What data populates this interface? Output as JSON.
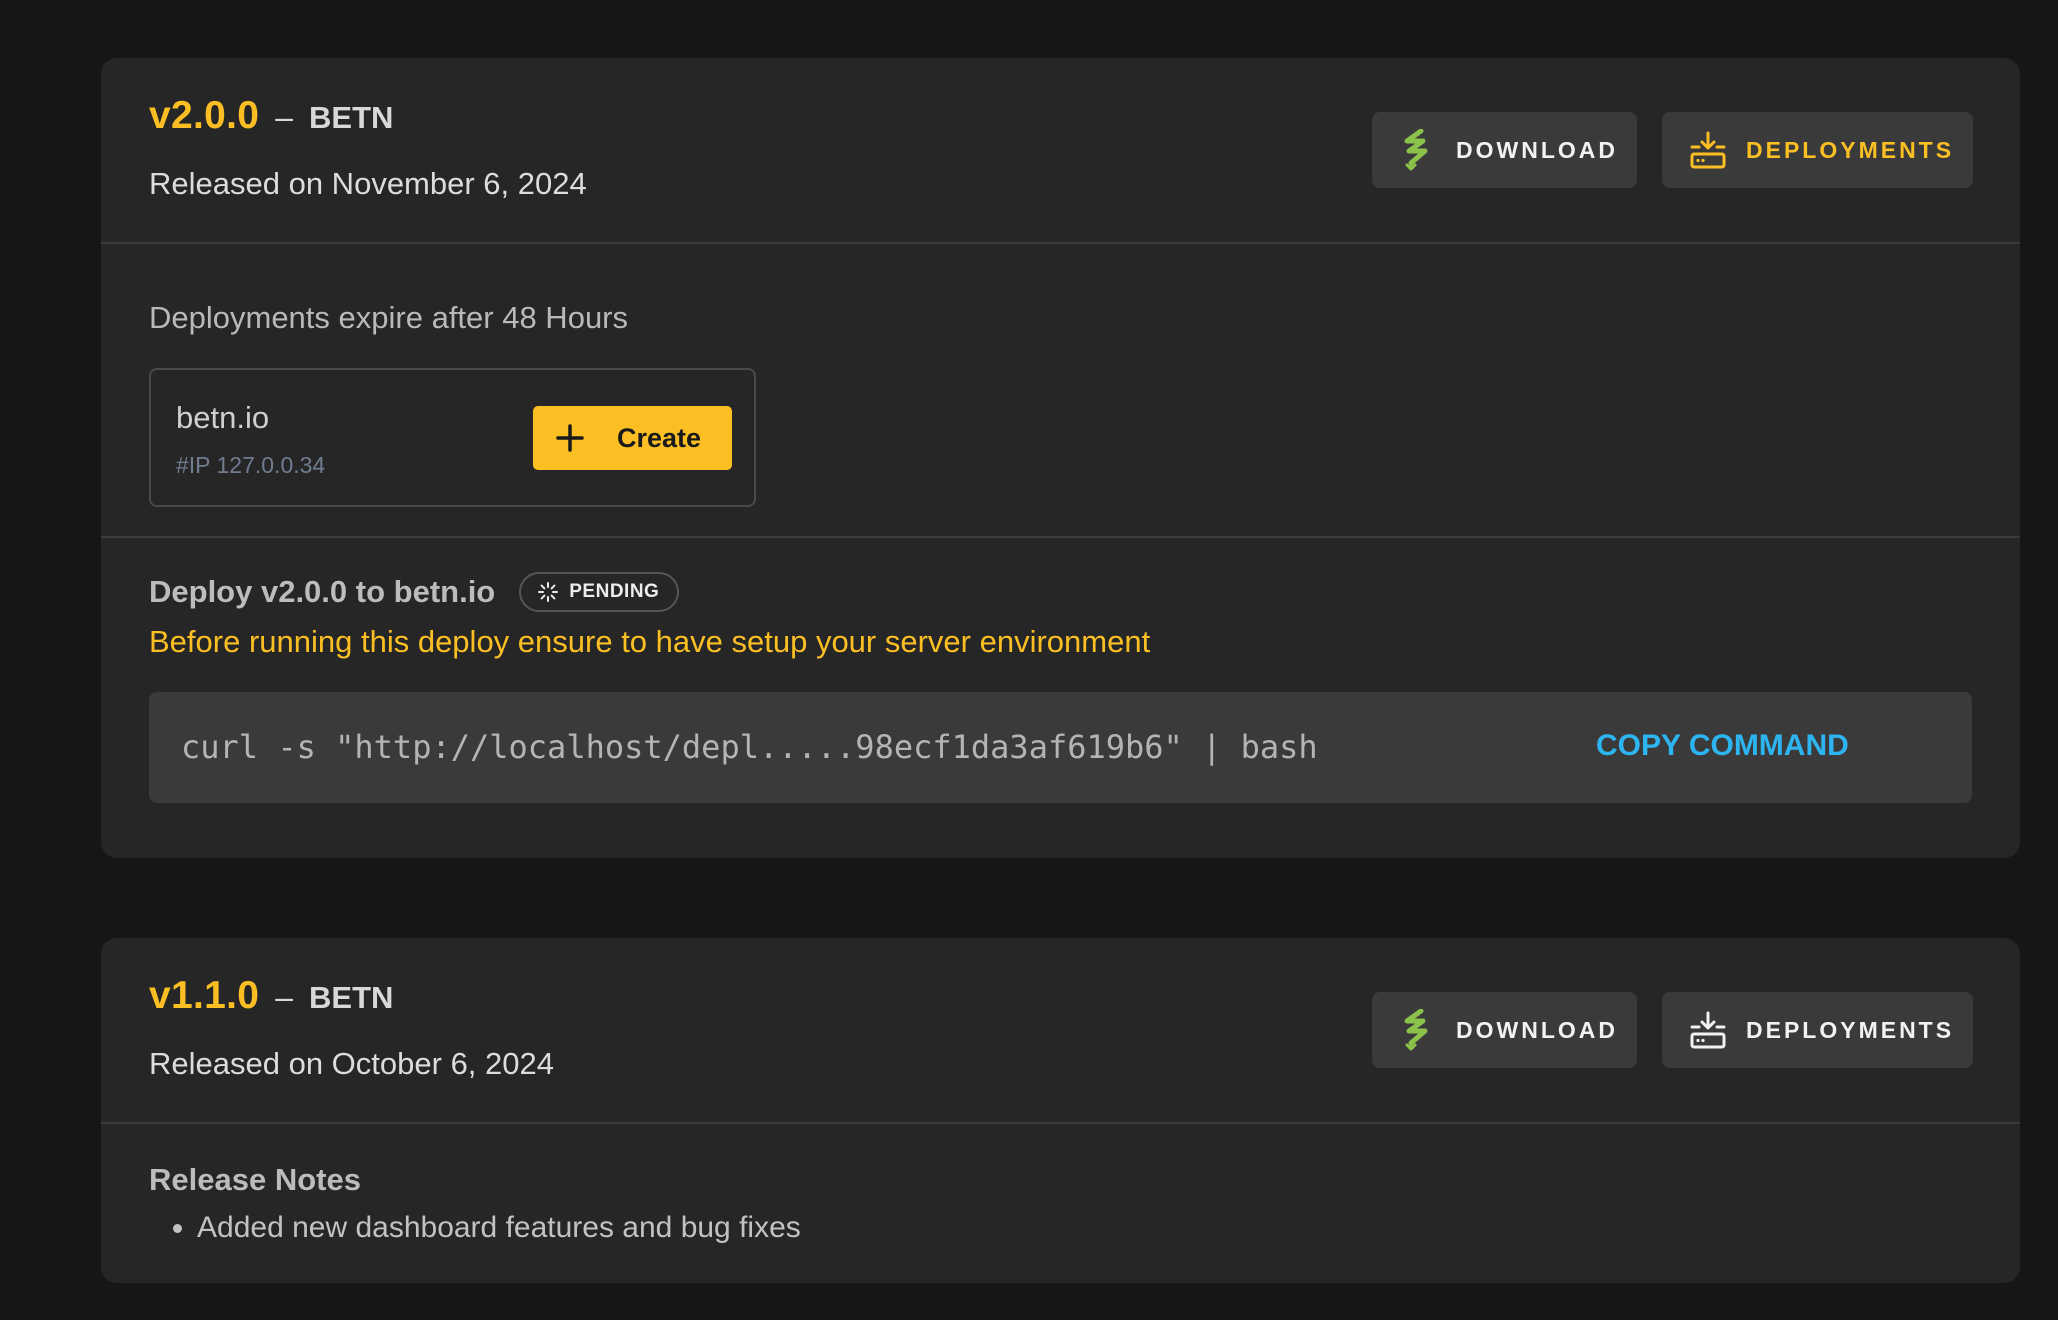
{
  "releases": [
    {
      "version": "v2.0.0",
      "separator": "–",
      "project": "BETN",
      "release_date": "Released on November 6, 2024",
      "download_label": "DOWNLOAD",
      "deployments_label": "DEPLOYMENTS",
      "deployments_active": true,
      "expire_note": "Deployments expire after 48 Hours",
      "host": {
        "name": "betn.io",
        "ip": "#IP 127.0.0.34",
        "create_label": "Create"
      },
      "task": {
        "title": "Deploy v2.0.0 to betn.io",
        "status": "PENDING",
        "warning": "Before running this deploy ensure to have setup your server environment",
        "command": "curl -s \"http://localhost/depl.....98ecf1da3af619b6\" | bash",
        "copy_label": "COPY COMMAND"
      }
    },
    {
      "version": "v1.1.0",
      "separator": "–",
      "project": "BETN",
      "release_date": "Released on October 6, 2024",
      "download_label": "DOWNLOAD",
      "deployments_label": "DEPLOYMENTS",
      "deployments_active": false,
      "notes_title": "Release Notes",
      "notes": [
        "Added new dashboard features and bug fixes"
      ]
    }
  ],
  "icons": {
    "download": "download-icon",
    "deployments": "server-download-icon",
    "create": "plus-icon",
    "status": "spinner-icon"
  },
  "colors": {
    "accent": "#fbbf24",
    "link": "#2db5f1",
    "download_icon": "#8bc34a",
    "card": "#262626",
    "background": "#161616"
  }
}
